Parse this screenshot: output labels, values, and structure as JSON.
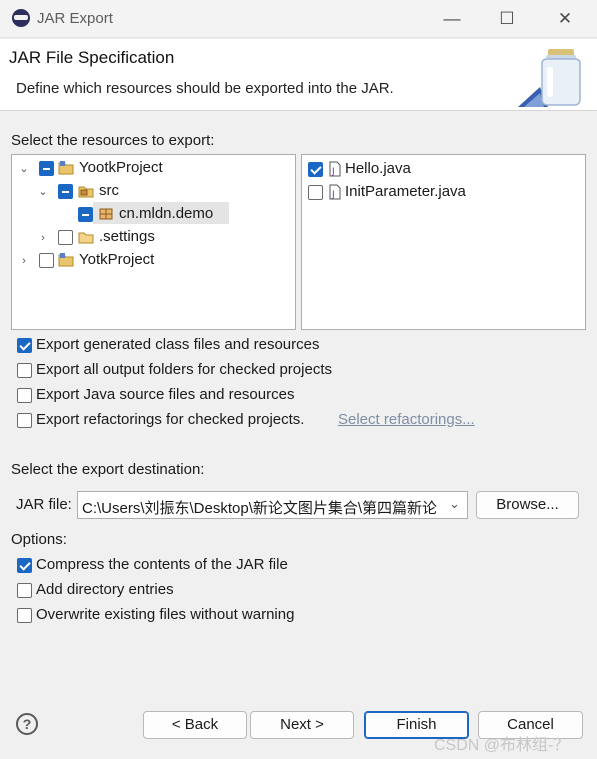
{
  "window": {
    "title": "JAR Export",
    "minimize": "—",
    "maximize": "☐",
    "close": "✕"
  },
  "header": {
    "title": "JAR File Specification",
    "description": "Define which resources should be exported into the JAR."
  },
  "resources": {
    "label": "Select the resources to export:",
    "tree": [
      {
        "label": "YootkProject",
        "state": "partial",
        "expanded": true,
        "icon": "project-icon"
      },
      {
        "label": "src",
        "state": "partial",
        "expanded": true,
        "icon": "package-folder-icon"
      },
      {
        "label": "cn.mldn.demo",
        "state": "partial",
        "icon": "package-icon",
        "selected": true
      },
      {
        "label": ".settings",
        "state": "unchecked",
        "expanded": false,
        "icon": "folder-icon"
      },
      {
        "label": "YotkProject",
        "state": "unchecked",
        "expanded": false,
        "icon": "project-icon"
      }
    ],
    "files": [
      {
        "label": "Hello.java",
        "state": "checked",
        "icon": "java-file-icon"
      },
      {
        "label": "InitParameter.java",
        "state": "unchecked",
        "icon": "java-file-icon"
      }
    ]
  },
  "export_options": [
    {
      "label": "Export generated class files and resources",
      "checked": true
    },
    {
      "label": "Export all output folders for checked projects",
      "checked": false
    },
    {
      "label": "Export Java source files and resources",
      "checked": false
    },
    {
      "label": "Export refactorings for checked projects.",
      "checked": false
    }
  ],
  "select_refactorings_link": "Select refactorings...",
  "destination": {
    "label": "Select the export destination:",
    "jar_file_label": "JAR file:",
    "jar_file_value": "C:\\Users\\刘振东\\Desktop\\新论文图片集合\\第四篇新论",
    "browse_button": "Browse..."
  },
  "options": {
    "label": "Options:",
    "items": [
      {
        "label": "Compress the contents of the JAR file",
        "checked": true
      },
      {
        "label": "Add directory entries",
        "checked": false
      },
      {
        "label": "Overwrite existing files without warning",
        "checked": false
      }
    ]
  },
  "footer": {
    "help": "?",
    "back": "< Back",
    "next": "Next >",
    "finish": "Finish",
    "cancel": "Cancel"
  },
  "watermark": "CSDN @布林组-？"
}
